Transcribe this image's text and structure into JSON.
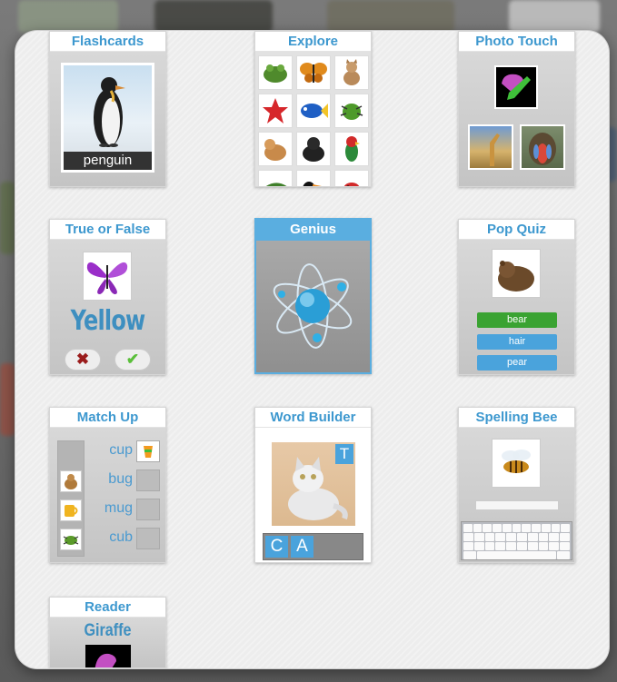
{
  "modal": {
    "cards": [
      {
        "id": "flashcards",
        "title": "Flashcards",
        "label": "penguin"
      },
      {
        "id": "explore",
        "title": "Explore"
      },
      {
        "id": "photo-touch",
        "title": "Photo Touch"
      },
      {
        "id": "true-or-false",
        "title": "True or False",
        "word": "Yellow"
      },
      {
        "id": "genius",
        "title": "Genius",
        "selected": true
      },
      {
        "id": "pop-quiz",
        "title": "Pop Quiz",
        "options": [
          "bear",
          "hair",
          "pear"
        ]
      },
      {
        "id": "match-up",
        "title": "Match Up",
        "words": [
          "cup",
          "bug",
          "mug",
          "cub"
        ]
      },
      {
        "id": "word-builder",
        "title": "Word Builder",
        "hint_tile": "T",
        "tiles": [
          "C",
          "A"
        ]
      },
      {
        "id": "spelling-bee",
        "title": "Spelling Bee"
      },
      {
        "id": "reader",
        "title": "Reader",
        "word": "Giraffe"
      }
    ]
  },
  "colors": {
    "accent": "#3d98cf",
    "selected": "#5aaee0",
    "quiz_correct": "#3aa332",
    "quiz_option": "#4aa3dc"
  }
}
